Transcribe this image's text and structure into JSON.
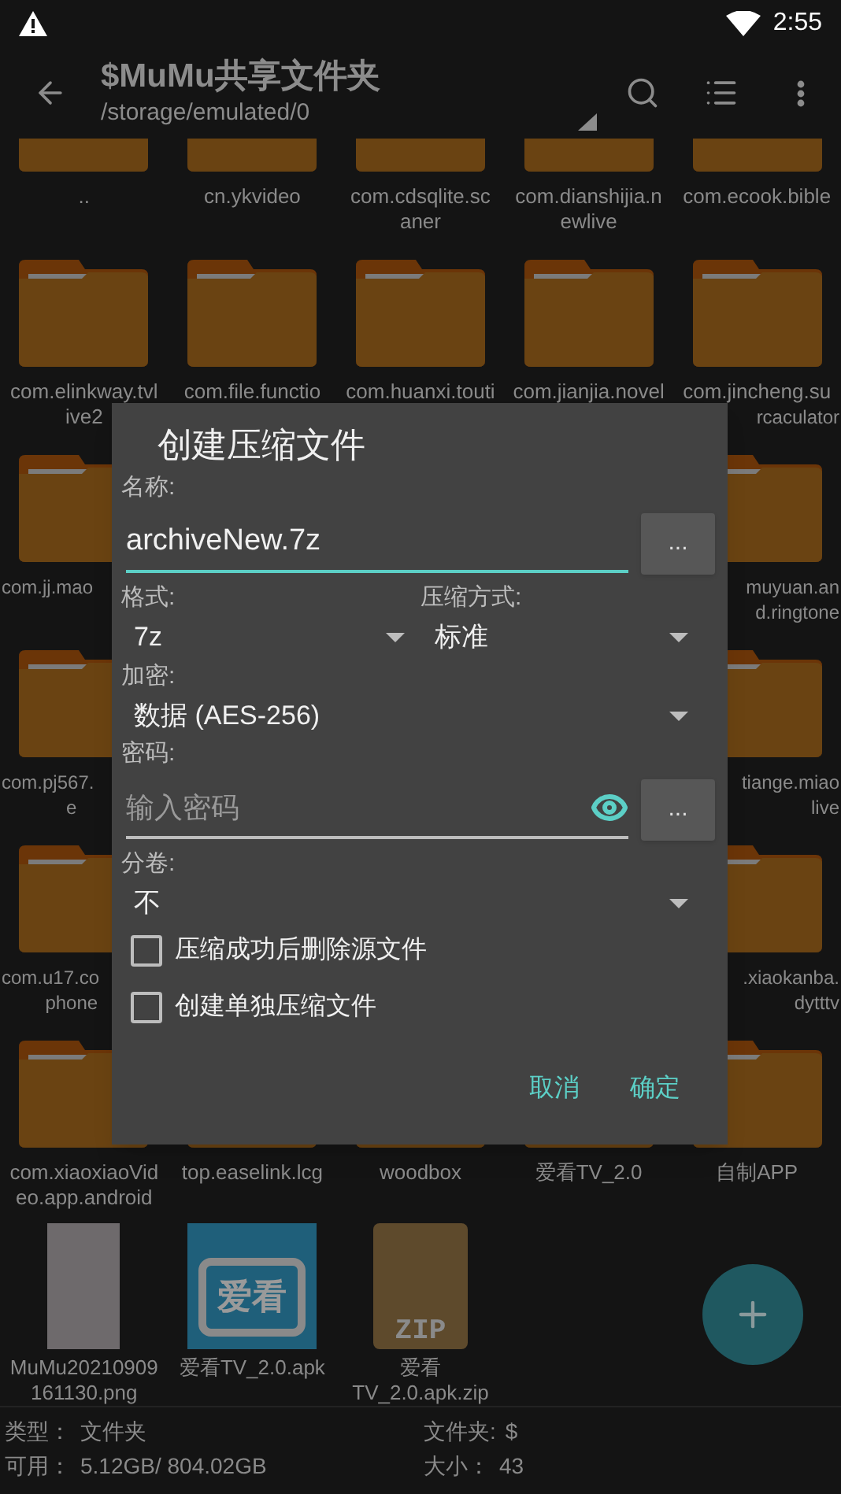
{
  "status_bar": {
    "time": "2:55"
  },
  "toolbar": {
    "title": "$MuMu共享文件夹",
    "path": "/storage/emulated/0"
  },
  "rows": [
    [
      {
        "kind": "parent",
        "lines": [
          ".."
        ]
      },
      {
        "kind": "folder",
        "lines": [
          "cn.ykvideo"
        ]
      },
      {
        "kind": "folder",
        "lines": [
          "com.cdsqlite.sc",
          "aner"
        ]
      },
      {
        "kind": "folder",
        "lines": [
          "com.dianshijia.n",
          "ewlive"
        ]
      },
      {
        "kind": "folder",
        "lines": [
          "com.ecook.bible"
        ]
      }
    ],
    [
      {
        "kind": "folder",
        "lines": [
          "com.elinkway.tvl",
          "ive2"
        ]
      },
      {
        "kind": "folder",
        "lines": [
          "com.file.functio"
        ]
      },
      {
        "kind": "folder",
        "lines": [
          "com.huanxi.touti"
        ]
      },
      {
        "kind": "folder",
        "lines": [
          "com.jianjia.novel"
        ]
      },
      {
        "kind": "folder",
        "lines": [
          "com.jincheng.su",
          "rcaculator"
        ]
      }
    ],
    [
      {
        "kind": "folder",
        "lines": [
          "com.jj.mao"
        ]
      },
      null,
      null,
      null,
      {
        "kind": "folder",
        "lines": [
          "muyuan.an",
          "d.ringtone"
        ]
      }
    ],
    [
      {
        "kind": "folder",
        "lines": [
          "com.pj567.",
          "e"
        ]
      },
      null,
      null,
      null,
      {
        "kind": "folder",
        "lines": [
          "tiange.miao",
          "live"
        ]
      }
    ],
    [
      {
        "kind": "folder",
        "lines": [
          "com.u17.co",
          "phone"
        ]
      },
      null,
      null,
      null,
      {
        "kind": "folder",
        "lines": [
          ".xiaokanba.",
          "dytttv"
        ]
      }
    ],
    [
      {
        "kind": "folder",
        "lines": [
          "com.xiaoxiaoVid",
          "eo.app.android"
        ]
      },
      {
        "kind": "folder",
        "lines": [
          "top.easelink.lcg"
        ]
      },
      {
        "kind": "folder",
        "lines": [
          "woodbox"
        ]
      },
      {
        "kind": "folder",
        "lines": [
          "爱看TV_2.0"
        ]
      },
      {
        "kind": "folder",
        "lines": [
          "自制APP"
        ]
      }
    ],
    [
      {
        "kind": "image",
        "lines": [
          "MuMu20210909",
          "161130.png"
        ]
      },
      {
        "kind": "apk",
        "icon_text": "爱看",
        "lines": [
          "爱看TV_2.0.apk"
        ]
      },
      {
        "kind": "zip",
        "icon_text": "ZIP",
        "lines": [
          "爱看",
          "TV_2.0.apk.zip"
        ]
      }
    ]
  ],
  "info": {
    "left": [
      {
        "label": "类型：",
        "value": "文件夹"
      },
      {
        "label": "可用：",
        "value": "5.12GB/ 804.02GB"
      }
    ],
    "right": [
      {
        "label": "文件夹:",
        "value": "$"
      },
      {
        "label": "大小：",
        "value": "43"
      }
    ]
  },
  "dialog": {
    "title": "创建压缩文件",
    "name_label": "名称:",
    "name_value": "archiveNew.7z",
    "name_browse": "...",
    "format_label": "格式:",
    "format_value": "7z",
    "method_label": "压缩方式:",
    "method_value": "标准",
    "encryption_label": "加密:",
    "encryption_value": "数据 (AES-256)",
    "password_label": "密码:",
    "password_placeholder": "输入密码",
    "password_browse": "...",
    "split_label": "分卷:",
    "split_value": "不",
    "options": [
      {
        "label": "压缩成功后删除源文件",
        "checked": false
      },
      {
        "label": "创建单独压缩文件",
        "checked": false
      }
    ],
    "buttons": [
      "取消",
      "确定"
    ]
  }
}
